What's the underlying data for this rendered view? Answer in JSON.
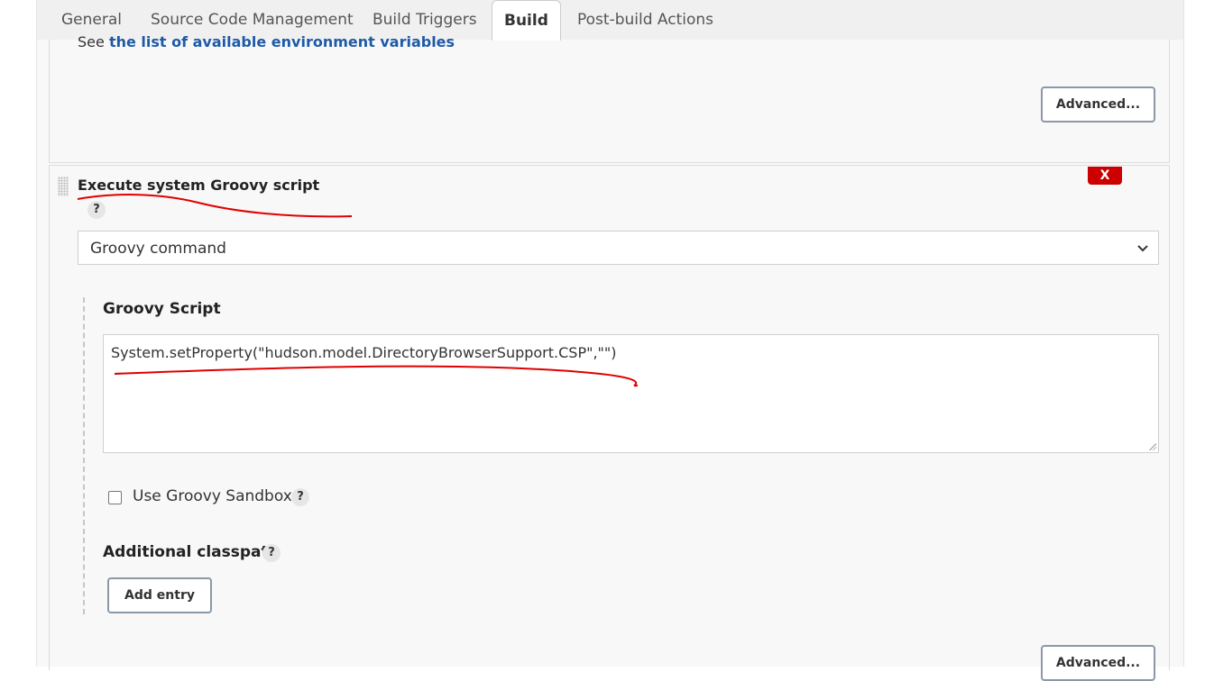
{
  "tabs": [
    {
      "label": "General",
      "active": false
    },
    {
      "label": "Source Code Management",
      "active": false
    },
    {
      "label": "Build Triggers",
      "active": false
    },
    {
      "label": "Build",
      "active": true
    },
    {
      "label": "Post-build Actions",
      "active": false
    }
  ],
  "env_vars": {
    "prefix": "See",
    "link_text": "the list of available environment variables"
  },
  "advanced_button": "Advanced...",
  "step": {
    "title": "Execute system Groovy script",
    "help": "?",
    "delete_label": "X",
    "source_select": "Groovy command",
    "script_label": "Groovy Script",
    "script_value": "System.setProperty(\"hudson.model.DirectoryBrowserSupport.CSP\",\"\")",
    "sandbox_label": "Use Groovy Sandbox",
    "sandbox_checked": false,
    "classpath_label": "Additional classpath",
    "add_entry_label": "Add entry",
    "advanced_label": "Advanced..."
  },
  "colors": {
    "link": "#1e5aa8",
    "delete": "#cc0000",
    "annotation": "#e00000"
  }
}
